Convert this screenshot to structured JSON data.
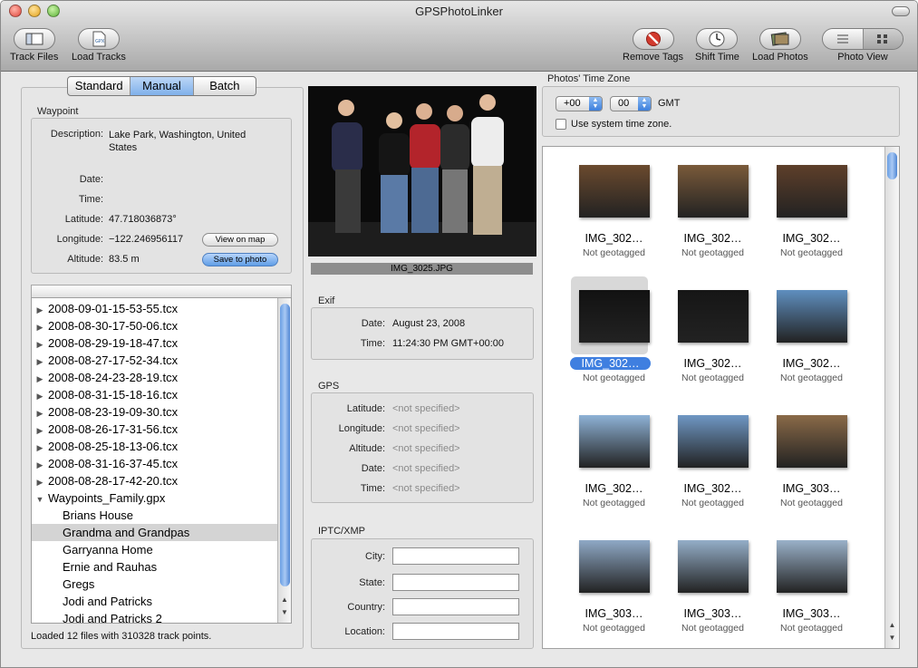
{
  "app": {
    "title": "GPSPhotoLinker"
  },
  "toolbar": {
    "track_files": "Track Files",
    "load_tracks": "Load Tracks",
    "gpx_icon_text": "GPX",
    "remove_tags": "Remove Tags",
    "shift_time": "Shift Time",
    "load_photos": "Load Photos",
    "photo_view": "Photo View"
  },
  "tabs": [
    "Standard",
    "Manual",
    "Batch"
  ],
  "waypoint": {
    "title": "Waypoint",
    "description_label": "Description:",
    "description": "Lake Park, Washington, United States",
    "date_label": "Date:",
    "time_label": "Time:",
    "latitude_label": "Latitude:",
    "latitude": "47.718036873°",
    "longitude_label": "Longitude:",
    "longitude": "−122.246956117",
    "altitude_label": "Altitude:",
    "altitude": "83.5 m",
    "view_on_map": "View on map",
    "save_to_photo": "Save to photo"
  },
  "track_list": {
    "files": [
      "2008-09-01-15-53-55.tcx",
      "2008-08-30-17-50-06.tcx",
      "2008-08-29-19-18-47.tcx",
      "2008-08-27-17-52-34.tcx",
      "2008-08-24-23-28-19.tcx",
      "2008-08-31-15-18-16.tcx",
      "2008-08-23-19-09-30.tcx",
      "2008-08-26-17-31-56.tcx",
      "2008-08-25-18-13-06.tcx",
      "2008-08-31-16-37-45.tcx",
      "2008-08-28-17-42-20.tcx"
    ],
    "group": "Waypoints_Family.gpx",
    "waypoints": [
      "Brians House",
      "Grandma and Grandpas",
      "Garryanna Home",
      "Ernie and Rauhas",
      "Gregs",
      "Jodi and Patricks",
      "Jodi and Patricks 2"
    ],
    "selected_waypoint": "Grandma and Grandpas"
  },
  "status": "Loaded 12 files with 310328 track points.",
  "preview": {
    "filename": "IMG_3025.JPG"
  },
  "exif": {
    "title": "Exif",
    "date_label": "Date:",
    "date": "August 23, 2008",
    "time_label": "Time:",
    "time": "11:24:30 PM GMT+00:00"
  },
  "gps": {
    "title": "GPS",
    "latitude_label": "Latitude:",
    "longitude_label": "Longitude:",
    "altitude_label": "Altitude:",
    "date_label": "Date:",
    "time_label": "Time:",
    "not_specified": "<not specified>"
  },
  "iptc": {
    "title": "IPTC/XMP",
    "city_label": "City:",
    "state_label": "State:",
    "country_label": "Country:",
    "location_label": "Location:"
  },
  "timezone": {
    "title": "Photos' Time Zone",
    "hours": "+00",
    "minutes": "00",
    "suffix": "GMT",
    "use_system": "Use system time zone."
  },
  "photos": [
    {
      "name": "IMG_302…",
      "status": "Not geotagged",
      "tone": "#6b4a2e",
      "selected": false
    },
    {
      "name": "IMG_302…",
      "status": "Not geotagged",
      "tone": "#7a5a3a",
      "selected": false
    },
    {
      "name": "IMG_302…",
      "status": "Not geotagged",
      "tone": "#5e3f2a",
      "selected": false
    },
    {
      "name": "IMG_302…",
      "status": "Not geotagged",
      "tone": "#121212",
      "selected": true
    },
    {
      "name": "IMG_302…",
      "status": "Not geotagged",
      "tone": "#161616",
      "selected": false
    },
    {
      "name": "IMG_302…",
      "status": "Not geotagged",
      "tone": "#5f8fbf",
      "selected": false
    },
    {
      "name": "IMG_302…",
      "status": "Not geotagged",
      "tone": "#8eb2d6",
      "selected": false
    },
    {
      "name": "IMG_302…",
      "status": "Not geotagged",
      "tone": "#6f97c4",
      "selected": false
    },
    {
      "name": "IMG_303…",
      "status": "Not geotagged",
      "tone": "#8a6a48",
      "selected": false
    },
    {
      "name": "IMG_303…",
      "status": "Not geotagged",
      "tone": "#8fa9c6",
      "selected": false
    },
    {
      "name": "IMG_303…",
      "status": "Not geotagged",
      "tone": "#94aec8",
      "selected": false
    },
    {
      "name": "IMG_303…",
      "status": "Not geotagged",
      "tone": "#9ab1c9",
      "selected": false
    }
  ],
  "colors": {
    "accent": "#3f7fe0",
    "selection": "#d4d4d4"
  }
}
